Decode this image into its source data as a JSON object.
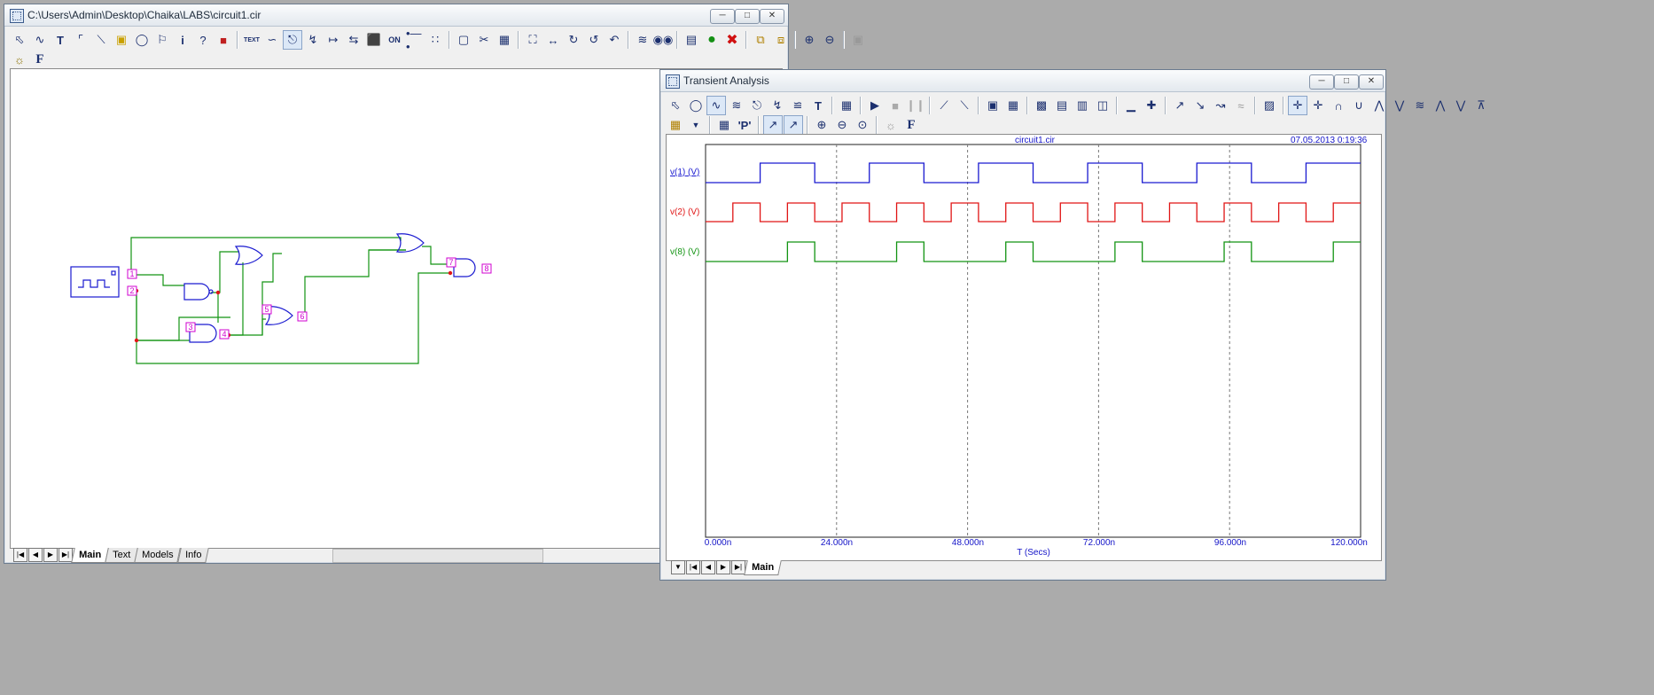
{
  "editor": {
    "title": "C:\\Users\\Admin\\Desktop\\Chaika\\LABS\\circuit1.cir",
    "toolbar_icons": [
      "select-icon",
      "wire-icon",
      "text-tool-icon",
      "orthogonal-wire-icon",
      "diagonal-line-icon",
      "component-icon",
      "flag-icon",
      "info-icon",
      "help-icon",
      "text-box-icon",
      "bus-icon",
      "stepping-icon",
      "arrow-icon",
      "on-off-icon",
      "link-icon",
      "grid-icon",
      "box-icon",
      "rotate-icon",
      "mirror-icon",
      "find-icon",
      "binoculars-icon",
      "green-dot-icon",
      "red-x-icon",
      "copy-icon",
      "paste-icon",
      "zoom-in-icon",
      "zoom-out-icon"
    ],
    "toolbar2": [
      "probe-icon",
      "font-icon"
    ],
    "font_glyph": "F",
    "text_label": "TEXT",
    "on_label": "ON",
    "node_labels": [
      "1",
      "2",
      "3",
      "4",
      "5",
      "6",
      "7",
      "8"
    ],
    "tabs": [
      "Main",
      "Text",
      "Models",
      "Info"
    ],
    "active_tab": "Main"
  },
  "analysis": {
    "title": "Transient Analysis",
    "header_file": "circuit1.cir",
    "header_date": "07.05.2013 0:19:36",
    "series_labels": [
      "v(1) (V)",
      "v(2) (V)",
      "v(8) (V)"
    ],
    "x_axis_title": "T (Secs)",
    "tabs": [
      "Main"
    ],
    "font_glyph": "F",
    "colors": {
      "v1": "#1a1ad0",
      "v2": "#e01515",
      "v8": "#139413",
      "axis": "#1414c8"
    }
  },
  "chart_data": {
    "type": "line",
    "title": "circuit1.cir",
    "xlabel": "T (Secs)",
    "ylabel": "",
    "x_ticks": [
      "0.000n",
      "24.000n",
      "48.000n",
      "72.000n",
      "96.000n",
      "120.000n"
    ],
    "xlim": [
      0,
      120
    ],
    "ylim": [
      0,
      1
    ],
    "grid": "vertical-dashed",
    "series": [
      {
        "name": "v(1) (V)",
        "color": "#1a1ad0",
        "x": [
          0,
          10,
          10,
          20,
          20,
          30,
          30,
          40,
          40,
          50,
          50,
          60,
          60,
          70,
          70,
          80,
          80,
          90,
          90,
          100,
          100,
          110,
          110,
          120
        ],
        "y": [
          0,
          0,
          1,
          1,
          0,
          0,
          1,
          1,
          0,
          0,
          1,
          1,
          0,
          0,
          1,
          1,
          0,
          0,
          1,
          1,
          0,
          0,
          1,
          1
        ]
      },
      {
        "name": "v(2) (V)",
        "color": "#e01515",
        "x": [
          0,
          5,
          5,
          10,
          10,
          15,
          15,
          20,
          20,
          25,
          25,
          30,
          30,
          35,
          35,
          40,
          40,
          45,
          45,
          50,
          50,
          55,
          55,
          60,
          60,
          65,
          65,
          70,
          70,
          75,
          75,
          80,
          80,
          85,
          85,
          90,
          90,
          95,
          95,
          100,
          100,
          105,
          105,
          110,
          110,
          115,
          115,
          120
        ],
        "y": [
          0,
          0,
          1,
          1,
          0,
          0,
          1,
          1,
          0,
          0,
          1,
          1,
          0,
          0,
          1,
          1,
          0,
          0,
          1,
          1,
          0,
          0,
          1,
          1,
          0,
          0,
          1,
          1,
          0,
          0,
          1,
          1,
          0,
          0,
          1,
          1,
          0,
          0,
          1,
          1,
          0,
          0,
          1,
          1,
          0,
          0,
          1,
          1
        ]
      },
      {
        "name": "v(8) (V)",
        "color": "#139413",
        "x": [
          0,
          15,
          15,
          20,
          20,
          35,
          35,
          40,
          40,
          55,
          55,
          60,
          60,
          75,
          75,
          80,
          80,
          95,
          95,
          100,
          100,
          115,
          115,
          120
        ],
        "y": [
          0,
          0,
          1,
          1,
          0,
          0,
          1,
          1,
          0,
          0,
          1,
          1,
          0,
          0,
          1,
          1,
          0,
          0,
          1,
          1,
          0,
          0,
          1,
          1
        ]
      }
    ]
  }
}
